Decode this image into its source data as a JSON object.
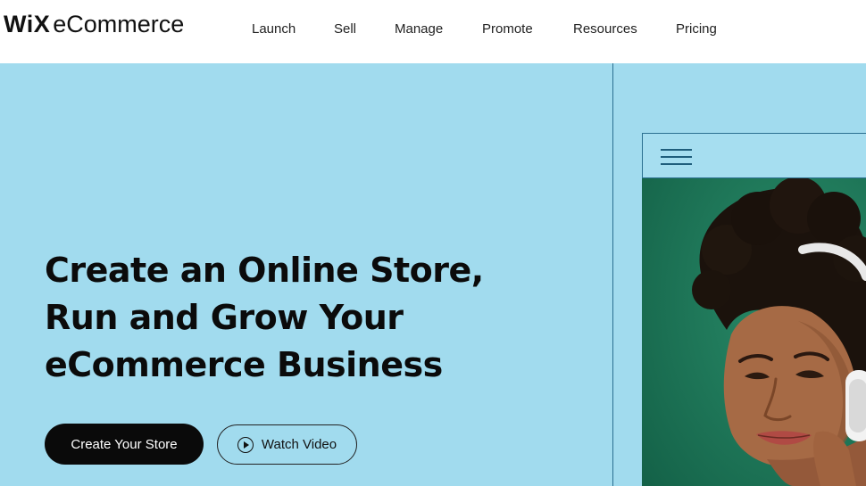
{
  "header": {
    "logo_wix": "WiX",
    "logo_suffix": "eCommerce",
    "nav": [
      "Launch",
      "Sell",
      "Manage",
      "Promote",
      "Resources",
      "Pricing"
    ]
  },
  "hero": {
    "headline": [
      "Create an Online Store,",
      "Run and Grow Your",
      "eCommerce Business"
    ],
    "primary_button": "Create Your Store",
    "secondary_button": "Watch Video"
  },
  "colors": {
    "hero_bg": "#a1dbee",
    "primary_button": "#0a0a0a",
    "image_bg": "#1d7a5c",
    "accent_line": "#2a6f90"
  },
  "icons": [
    "play-icon",
    "hamburger-menu-icon"
  ]
}
